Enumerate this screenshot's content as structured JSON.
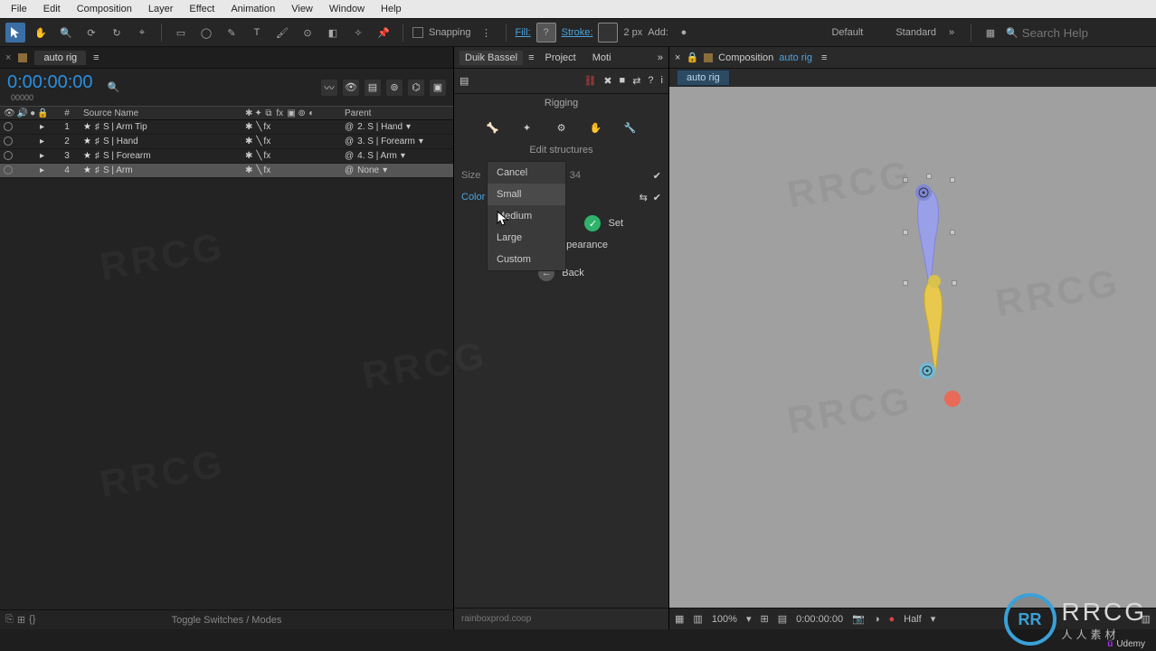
{
  "menubar": [
    "File",
    "Edit",
    "Composition",
    "Layer",
    "Effect",
    "Animation",
    "View",
    "Window",
    "Help"
  ],
  "toolbar": {
    "snapping": "Snapping",
    "fill": "Fill:",
    "stroke": "Stroke:",
    "stroke_px": "2 px",
    "add": "Add:",
    "workspace1": "Default",
    "workspace2": "Standard",
    "search_placeholder": "Search Help"
  },
  "left": {
    "tab": "auto rig",
    "timecode": "0:00:00:00",
    "timecode_sub": "00000",
    "search_placeholder": "",
    "head_num": "#",
    "head_source": "Source Name",
    "head_parent": "Parent",
    "rows": [
      {
        "num": "1",
        "name": "S | Arm Tip",
        "parent": "2. S | Hand",
        "selected": false
      },
      {
        "num": "2",
        "name": "S | Hand",
        "parent": "3. S | Forearm",
        "selected": false
      },
      {
        "num": "3",
        "name": "S | Forearm",
        "parent": "4. S | Arm",
        "selected": false
      },
      {
        "num": "4",
        "name": "S | Arm",
        "parent": "None",
        "selected": true
      }
    ],
    "footer_toggle": "Toggle Switches / Modes"
  },
  "mid": {
    "tabs": {
      "t1": "Duik Bassel",
      "t2": "Project",
      "t3": "Moti",
      "more": "»"
    },
    "title": "Rigging",
    "subtitle": "Edit structures",
    "size_label": "Size",
    "size_value": "34",
    "color_label": "Color",
    "dropdown": [
      "Cancel",
      "Small",
      "Medium",
      "Large",
      "Custom"
    ],
    "set_btn": "Set",
    "bake_btn": "Bake appearance",
    "back_btn": "Back",
    "footer": "rainboxprod.coop"
  },
  "viewer": {
    "tab_prefix": "Composition",
    "tab_name": "auto rig",
    "crumb": "auto rig",
    "zoom": "100%",
    "time": "0:00:00:00",
    "res": "Half"
  },
  "overlay": {
    "wm": "RRCG",
    "logo_text": "RRCG",
    "logo_inner": "RR",
    "cn": "人人素材",
    "udemy": "Udemy"
  }
}
